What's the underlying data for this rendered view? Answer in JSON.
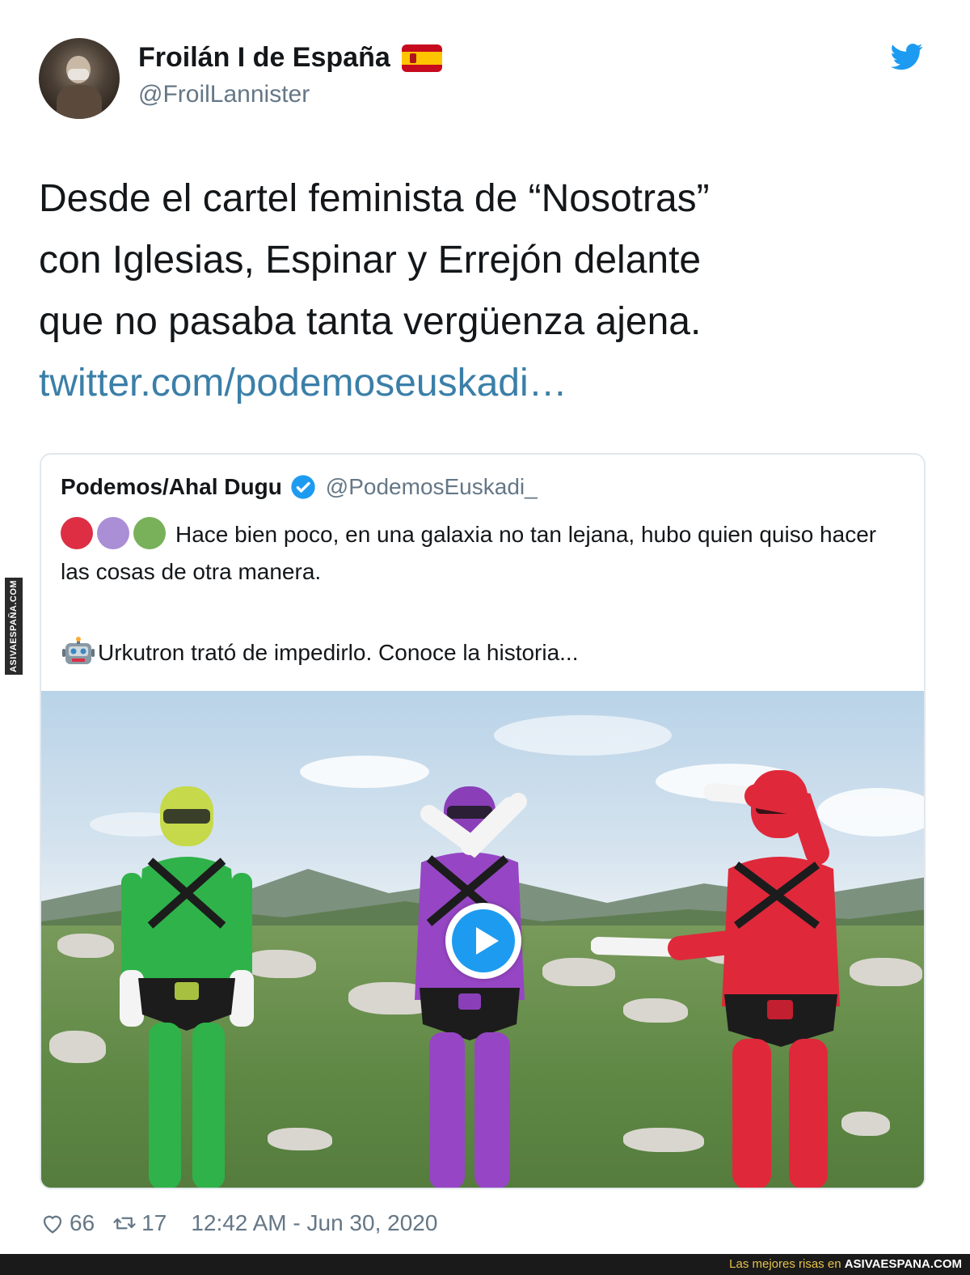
{
  "tweet": {
    "display_name": "Froilán I de España",
    "handle": "@FroilLannister",
    "text_line1": "Desde el cartel feminista de “Nosotras”",
    "text_line2": "con Iglesias, Espinar y Errejón delante",
    "text_line3": "que no pasaba tanta vergüenza ajena.",
    "link": "twitter.com/podemoseuskadi…",
    "likes": "66",
    "retweets": "17",
    "timestamp": "12:42 AM - Jun 30, 2020"
  },
  "quoted_tweet": {
    "display_name": "Podemos/Ahal Dugu",
    "handle": "@PodemosEuskadi_",
    "text": "Hace bien poco, en una galaxia no tan lejana, hubo quien quiso hacer las cosas de otra manera.",
    "text_line2": "Urkutron trató de impedirlo. Conoce la historia...",
    "dot_colors": [
      "#dd2e44",
      "#aa8ed6",
      "#78b159"
    ]
  },
  "icons": {
    "twitter": "twitter-bird-icon",
    "verified": "verified-badge-icon",
    "like": "heart-icon",
    "retweet": "retweet-icon",
    "robot": "robot-icon",
    "play": "play-icon",
    "flag": "spain-flag-icon"
  },
  "colors": {
    "link": "#3b7fa8",
    "twitter_blue": "#1d9bf0",
    "secondary_text": "#657786"
  },
  "watermark": {
    "side": "ASIVAESPAÑA.COM",
    "footer_prefix": "Las mejores risas en ",
    "footer_site": "ASIVAESPANA.COM"
  }
}
